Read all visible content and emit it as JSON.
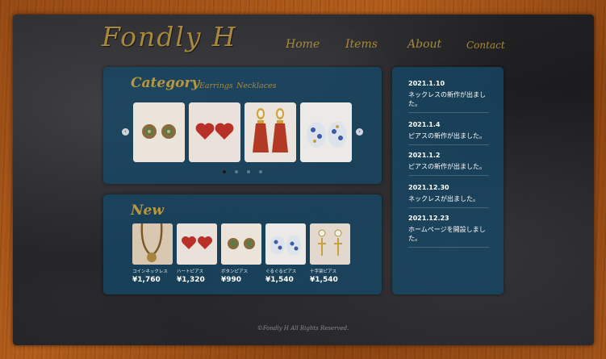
{
  "brand": {
    "logo": "Fondly H"
  },
  "nav": [
    {
      "label": "Home"
    },
    {
      "label": "Items"
    },
    {
      "label": "About"
    },
    {
      "label": "Contact"
    }
  ],
  "category": {
    "title": "Category",
    "links": [
      "Earrings",
      "Necklaces"
    ],
    "carousel": {
      "items": [
        {
          "icon": "bronze-button-earring-image"
        },
        {
          "icon": "red-heart-earring-image"
        },
        {
          "icon": "red-tassel-earring-image"
        },
        {
          "icon": "blue-flower-earring-image"
        }
      ],
      "prev_icon": "chevron-left-icon",
      "next_icon": "chevron-right-icon",
      "prev_glyph": "‹",
      "next_glyph": "›",
      "page_count": 4,
      "active_page": 1
    }
  },
  "new": {
    "title": "New",
    "items": [
      {
        "name": "コインネックレス",
        "price": "¥1,760",
        "icon": "coin-necklace-image"
      },
      {
        "name": "ハートピアス",
        "price": "¥1,320",
        "icon": "heart-earring-image"
      },
      {
        "name": "ボタンピアス",
        "price": "¥990",
        "icon": "button-earring-image"
      },
      {
        "name": "ぐるぐるピアス",
        "price": "¥1,540",
        "icon": "swirl-earring-image"
      },
      {
        "name": "十字架ピアス",
        "price": "¥1,540",
        "icon": "cross-earring-image"
      }
    ]
  },
  "news": [
    {
      "date": "2021.1.10",
      "text": "ネックレスの新作が出ました。"
    },
    {
      "date": "2021.1.4",
      "text": "ピアスの新作が出ました。"
    },
    {
      "date": "2021.1.2",
      "text": "ピアスの新作が出ました。"
    },
    {
      "date": "2021.12.30",
      "text": "ネックレスが出ました。"
    },
    {
      "date": "2021.12.23",
      "text": "ホームページを開設しました。"
    }
  ],
  "footer": {
    "text": "©Fondly H All Rights Reserved."
  },
  "colors": {
    "gold": "#a8883a",
    "panel": "#164866",
    "wood": "#a5561a",
    "slate": "#222224"
  }
}
